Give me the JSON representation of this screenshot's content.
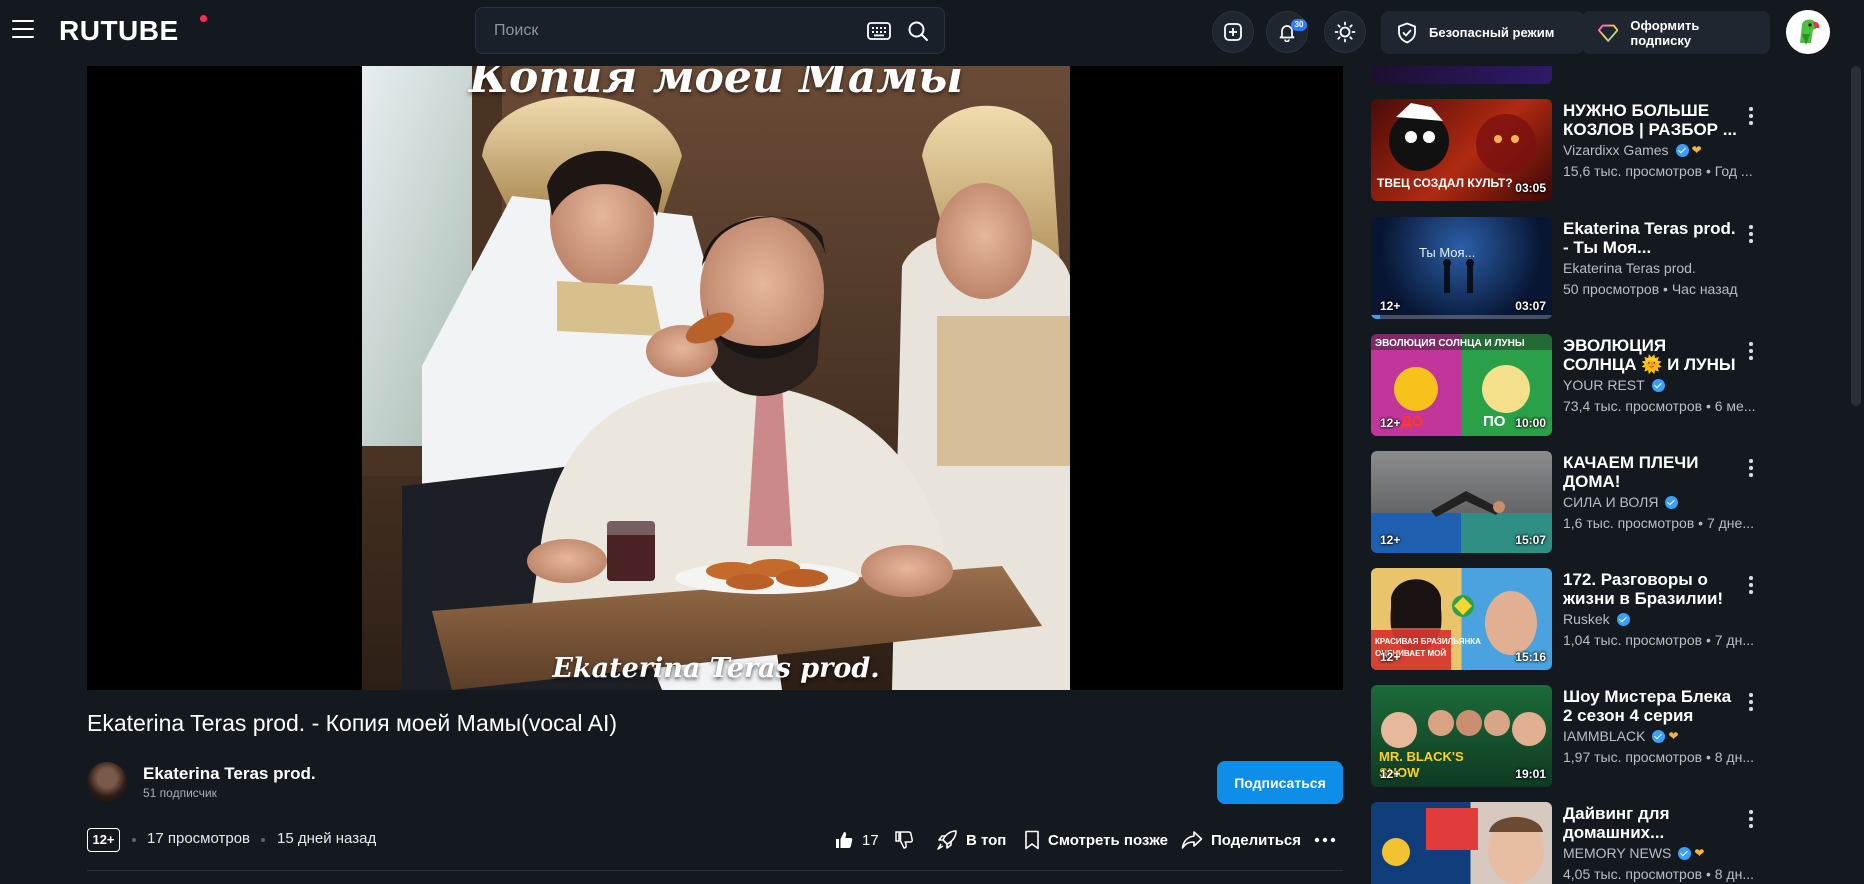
{
  "header": {
    "logo": "RUTUBE",
    "search_placeholder": "Поиск",
    "notifications_count": "30",
    "safe_mode_label": "Безопасный режим",
    "subscribe_premium_label": "Оформить подписку"
  },
  "video": {
    "overlay_top": "Копия моей Мамы",
    "overlay_bottom": "Ekaterina Teras prod.",
    "title": "Ekaterina Teras prod. - Копия моей Мамы(vocal AI)",
    "age_rating": "12+",
    "views": "17 просмотров",
    "published": "15 дней назад",
    "likes": "17",
    "actions": {
      "top": "В топ",
      "watch_later": "Смотреть позже",
      "share": "Поделиться"
    }
  },
  "channel": {
    "name": "Ekaterina Teras prod.",
    "subscribers": "51 подписчик",
    "subscribe_label": "Подписаться"
  },
  "recommendations": [
    {
      "title": "НУЖНО БОЛЬШЕ КОЗЛОВ | РАЗБОР ...",
      "channel": "Vizardixx Games",
      "verified": true,
      "heart": true,
      "stats": "15,6 тыс. просмотров • Год ...",
      "duration": "03:05",
      "age": "",
      "progress": 0
    },
    {
      "title": "Ekaterina Teras prod. - Ты Моя...",
      "channel": "Ekaterina Teras prod.",
      "verified": false,
      "heart": false,
      "stats": "50 просмотров • Час назад",
      "duration": "03:07",
      "age": "12+",
      "progress": 0.05
    },
    {
      "title": "ЭВОЛЮЦИЯ СОЛНЦА 🌞 И ЛУНЫ🌛 ВСЕ...",
      "channel": "YOUR REST",
      "verified": true,
      "heart": false,
      "stats": "73,4 тыс. просмотров • 6 ме...",
      "duration": "10:00",
      "age": "12+",
      "progress": 0
    },
    {
      "title": "КАЧАЕМ ПЛЕЧИ ДОМА!",
      "channel": "СИЛА И ВОЛЯ",
      "verified": true,
      "heart": false,
      "stats": "1,6 тыс. просмотров • 7 дне...",
      "duration": "15:07",
      "age": "12+",
      "progress": 0
    },
    {
      "title": "172. Разговоры о жизни в Бразилии!",
      "channel": "Ruskek",
      "verified": true,
      "heart": false,
      "stats": "1,04 тыс. просмотров • 7 дн...",
      "duration": "15:16",
      "age": "12+",
      "progress": 0
    },
    {
      "title": "Шоу Мистера Блека 2 сезон 4 серия",
      "channel": "IAMMBLACK",
      "verified": true,
      "heart": true,
      "stats": "1,97 тыс. просмотров • 8 дн...",
      "duration": "19:01",
      "age": "12+",
      "progress": 0
    },
    {
      "title": "Дайвинг для домашних...",
      "channel": "MEMORY NEWS",
      "verified": true,
      "heart": true,
      "stats": "4,05 тыс. просмотров • 8 дн...",
      "duration": "",
      "age": "",
      "progress": 0
    }
  ]
}
